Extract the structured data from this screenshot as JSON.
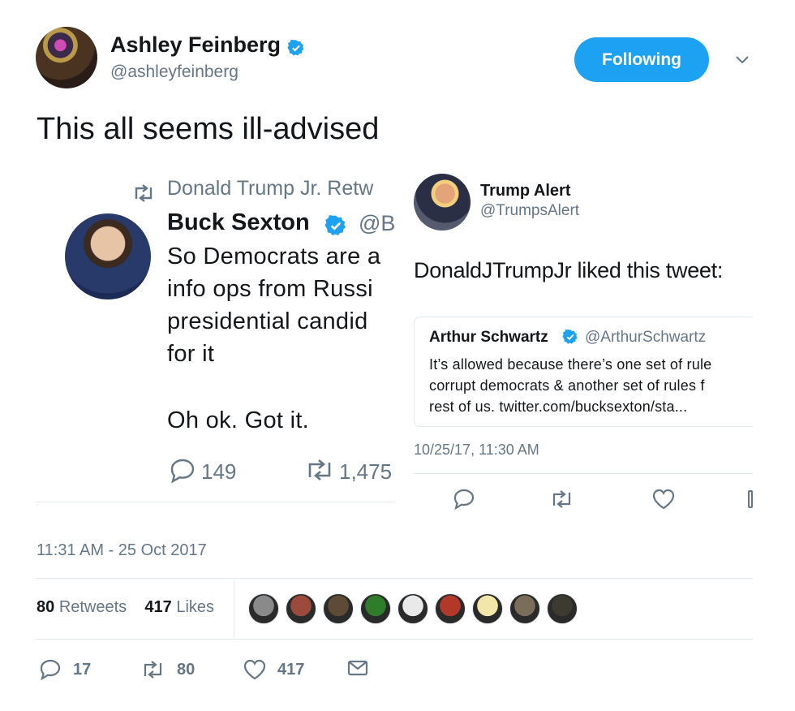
{
  "header": {
    "name": "Ashley Feinberg",
    "handle": "@ashleyfeinberg",
    "follow_label": "Following"
  },
  "tweet": {
    "text": "This all seems ill-advised"
  },
  "left_embed": {
    "retweet_context": "Donald Trump Jr. Retw",
    "author_name": "Buck Sexton",
    "author_handle": "@B",
    "lines": [
      "So Democrats are a",
      "info ops from Russi",
      "presidential candid",
      "for it",
      "Oh ok. Got it."
    ],
    "reply_count": "149",
    "retweet_count": "1,475"
  },
  "right_embed": {
    "author_name": "Trump Alert",
    "author_handle": "@TrumpsAlert",
    "text": "DonaldJTrumpJr liked this tweet:",
    "quote": {
      "author_name": "Arthur Schwartz",
      "author_handle": "@ArthurSchwartz",
      "lines": [
        "It’s allowed because there’s one set of rule",
        "corrupt democrats & another set of rules f",
        "rest of us. twitter.com/bucksexton/sta..."
      ]
    },
    "timestamp": "10/25/17, 11:30 AM"
  },
  "meta": {
    "timestamp": "11:31 AM - 25 Oct 2017",
    "retweets_count": "80",
    "retweets_label": "Retweets",
    "likes_count": "417",
    "likes_label": "Likes"
  },
  "actions": {
    "reply_count": "17",
    "retweet_count": "80",
    "like_count": "417"
  },
  "likers": [
    {
      "name": "liker-1",
      "color": "#8a8a8a"
    },
    {
      "name": "liker-2",
      "color": "#9c4a3c"
    },
    {
      "name": "liker-3",
      "color": "#5d4a37"
    },
    {
      "name": "liker-4",
      "color": "#2f7d2a"
    },
    {
      "name": "liker-5",
      "color": "#e9e9e9"
    },
    {
      "name": "liker-6",
      "color": "#b2382a"
    },
    {
      "name": "liker-7",
      "color": "#f2e7a8"
    },
    {
      "name": "liker-8",
      "color": "#7a6d5a"
    },
    {
      "name": "liker-9",
      "color": "#3d3a2f"
    }
  ],
  "colors": {
    "accent": "#1da1f2",
    "muted": "#657786",
    "text": "#14171a",
    "border": "#e1e8ed"
  }
}
